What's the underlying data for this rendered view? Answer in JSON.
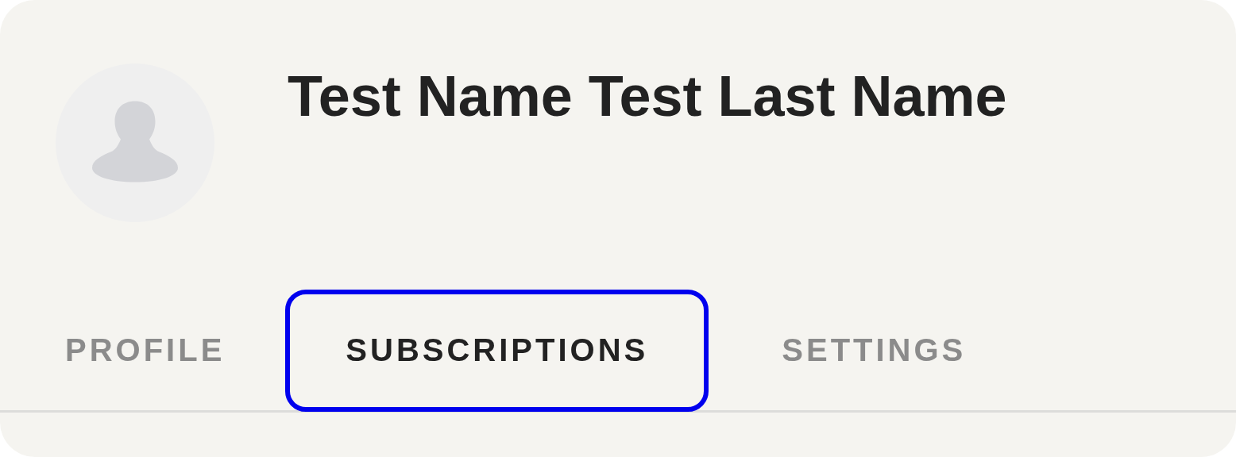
{
  "profile": {
    "name": "Test Name Test Last Name"
  },
  "tabs": [
    {
      "label": "PROFILE",
      "selected": false
    },
    {
      "label": "SUBSCRIPTIONS",
      "selected": true
    },
    {
      "label": "SETTINGS",
      "selected": false
    }
  ]
}
